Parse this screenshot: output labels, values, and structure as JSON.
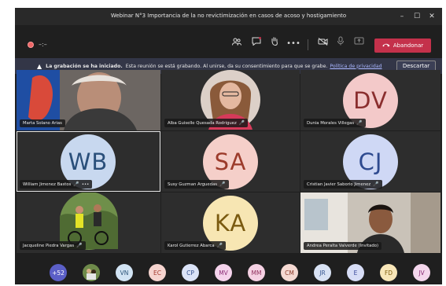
{
  "window": {
    "title": "Webinar N°3 Importancia de la no revictimización en casos de acoso y hostigamiento"
  },
  "toolbar": {
    "timer": "–:–",
    "leave_label": "Abandonar"
  },
  "banner": {
    "bold": "La grabación se ha iniciado.",
    "text": "Esta reunión se está grabando. Al unirse, da su consentimiento para que se grabe.",
    "link": "Política de privacidad",
    "dismiss": "Descartar"
  },
  "participants": [
    {
      "name": "Marta Solano Arias",
      "initials": "",
      "photo": "portrait-blue"
    },
    {
      "name": "Alba Guiselle Quesada Rodriguez",
      "initials": "",
      "photo": "portrait-woman"
    },
    {
      "name": "Dunia Morales Villegas",
      "initials": "DV",
      "color": "#f3c9c9",
      "fg": "#8a2e2e"
    },
    {
      "name": "William Jimenez Bastos",
      "initials": "WB",
      "color": "#c8d8ef",
      "fg": "#2a4f7a",
      "selected": true
    },
    {
      "name": "Susy Guzman Arguedas",
      "initials": "SA",
      "color": "#f5cfc9",
      "fg": "#9c3b2b"
    },
    {
      "name": "Cristian Javier Saborio Jimenez",
      "initials": "CJ",
      "color": "#cfd8f5",
      "fg": "#2e4a8f"
    },
    {
      "name": "Jacqueline Piedra Vargas",
      "initials": "",
      "photo": "portrait-cyclists"
    },
    {
      "name": "Karol Gutierrez Abarca",
      "initials": "KA",
      "color": "#f7e6b3",
      "fg": "#7a5a10"
    },
    {
      "name": "Andrea Peralta Valverde (Invitado)",
      "initials": "",
      "photo": "portrait-room"
    }
  ],
  "strip": [
    {
      "label": "+52",
      "bg": "#5b5fc7",
      "fg": "#ffffff"
    },
    {
      "label": "",
      "bg": "#6e8a4a",
      "fg": "#ffffff",
      "photo": true
    },
    {
      "label": "VN",
      "bg": "#d2e4f4",
      "fg": "#2c5478"
    },
    {
      "label": "EC",
      "bg": "#f6d4cf",
      "fg": "#a53b2e"
    },
    {
      "label": "CP",
      "bg": "#dbe3f7",
      "fg": "#33508f"
    },
    {
      "label": "MV",
      "bg": "#f5d3ec",
      "fg": "#8d2f78"
    },
    {
      "label": "MM",
      "bg": "#f5d1e3",
      "fg": "#8f2f5c"
    },
    {
      "label": "CM",
      "bg": "#f5d9d2",
      "fg": "#8c3a2a"
    },
    {
      "label": "JR",
      "bg": "#d8e2f4",
      "fg": "#345590"
    },
    {
      "label": "E",
      "bg": "#d7ddf6",
      "fg": "#38479a"
    },
    {
      "label": "FD",
      "bg": "#f8e6b8",
      "fg": "#80600f"
    },
    {
      "label": "JV",
      "bg": "#f4d6ec",
      "fg": "#8a2f76"
    }
  ]
}
